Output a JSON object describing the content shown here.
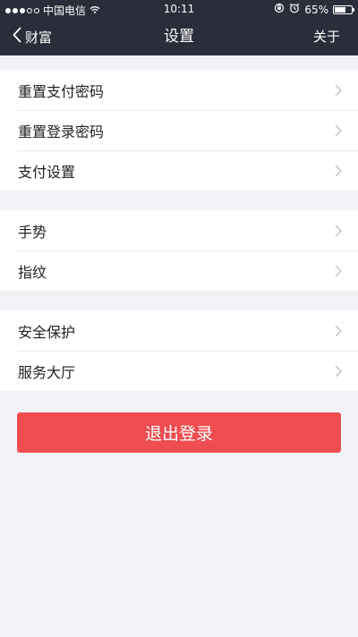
{
  "status_bar": {
    "carrier": "中国电信",
    "time": "10:11",
    "battery_text": "65%",
    "battery_level": 0.65,
    "icons": [
      "signal-icon",
      "wifi-icon",
      "lock-rotation-icon",
      "alarm-icon",
      "battery-icon"
    ]
  },
  "nav": {
    "back_label": "财富",
    "title": "设置",
    "right_label": "关于"
  },
  "groups": [
    {
      "items": [
        {
          "label": "重置支付密码"
        },
        {
          "label": "重置登录密码"
        },
        {
          "label": "支付设置"
        }
      ]
    },
    {
      "items": [
        {
          "label": "手势"
        },
        {
          "label": "指纹"
        }
      ]
    },
    {
      "items": [
        {
          "label": "安全保护"
        },
        {
          "label": "服务大厅"
        }
      ]
    }
  ],
  "logout_label": "退出登录",
  "colors": {
    "header_bg": "#2a2d3a",
    "page_bg": "#f2f2f6",
    "logout_bg": "#ef4d50"
  }
}
